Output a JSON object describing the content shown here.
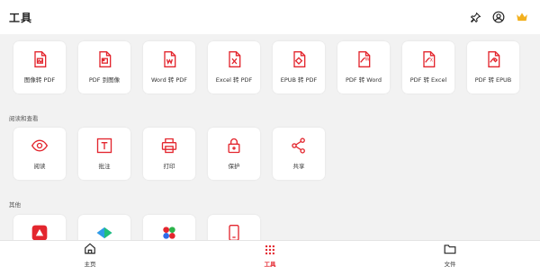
{
  "header": {
    "title": "工具"
  },
  "colors": {
    "accent": "#e3262e",
    "crown": "#f2b01e"
  },
  "tools_top": [
    {
      "label": "图像转 PDF",
      "icon": "image-to-pdf-icon"
    },
    {
      "label": "PDF 到图像",
      "icon": "pdf-to-image-icon"
    },
    {
      "label": "Word 转 PDF",
      "icon": "word-to-pdf-icon"
    },
    {
      "label": "Excel 转 PDF",
      "icon": "excel-to-pdf-icon"
    },
    {
      "label": "EPUB 转 PDF",
      "icon": "epub-to-pdf-icon"
    },
    {
      "label": "PDF 转 Word",
      "icon": "pdf-to-word-icon"
    },
    {
      "label": "PDF 转 Excel",
      "icon": "pdf-to-excel-icon"
    },
    {
      "label": "PDF 转 EPUB",
      "icon": "pdf-to-epub-icon"
    }
  ],
  "read_section": {
    "title": "阅读和查看",
    "items": [
      {
        "label": "阅读",
        "icon": "eye-icon"
      },
      {
        "label": "批注",
        "icon": "text-annotate-icon"
      },
      {
        "label": "打印",
        "icon": "printer-icon"
      },
      {
        "label": "保护",
        "icon": "lock-icon"
      },
      {
        "label": "共享",
        "icon": "share-icon"
      }
    ]
  },
  "other_section": {
    "title": "其他"
  },
  "bottom_nav": [
    {
      "label": "主页",
      "icon": "home-icon"
    },
    {
      "label": "工具",
      "icon": "grid-icon"
    },
    {
      "label": "文件",
      "icon": "folder-icon"
    }
  ]
}
